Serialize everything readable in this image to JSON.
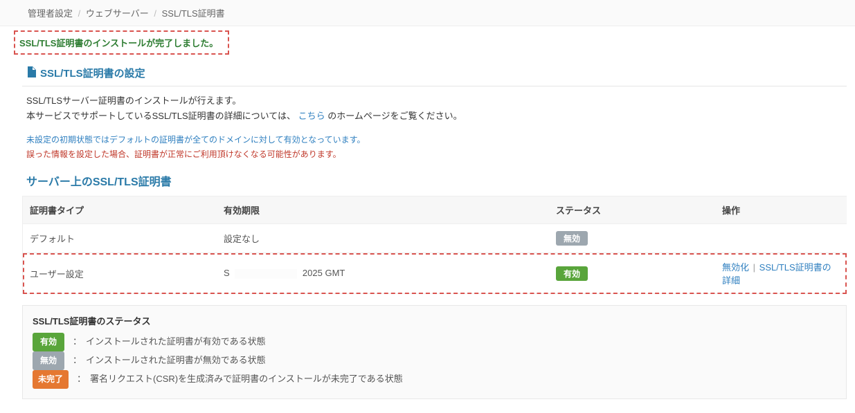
{
  "breadcrumb": {
    "item1": "管理者設定",
    "item2": "ウェブサーバー",
    "item3": "SSL/TLS証明書"
  },
  "success_message": "SSL/TLS証明書のインストールが完了しました。",
  "section": {
    "title": "SSL/TLS証明書の設定"
  },
  "description": {
    "line1": "SSL/TLSサーバー証明書のインストールが行えます。",
    "line2_prefix": "本サービスでサポートしているSSL/TLS証明書の詳細については、",
    "line2_link": "こちら",
    "line2_suffix": " のホームページをご覧ください。"
  },
  "notes": {
    "blue": "未設定の初期状態ではデフォルトの証明書が全てのドメインに対して有効となっています。",
    "red": "誤った情報を設定した場合、証明書が正常にご利用頂けなくなる可能性があります。"
  },
  "table": {
    "heading": "サーバー上のSSL/TLS証明書",
    "columns": {
      "type": "証明書タイプ",
      "expiry": "有効期限",
      "status": "ステータス",
      "action": "操作"
    },
    "rows": [
      {
        "type": "デフォルト",
        "expiry_prefix": "設定なし",
        "expiry_suffix": "",
        "status_label": "無効",
        "status_style": "badge-gray",
        "actions": []
      },
      {
        "type": "ユーザー設定",
        "expiry_prefix": "S",
        "expiry_suffix": "2025 GMT",
        "status_label": "有効",
        "status_style": "badge-green",
        "actions": [
          "無効化",
          "SSL/TLS証明書の詳細"
        ]
      }
    ]
  },
  "status_box": {
    "title": "SSL/TLS証明書のステータス",
    "items": [
      {
        "label": "有効",
        "style": "badge-green",
        "desc": "インストールされた証明書が有効である状態"
      },
      {
        "label": "無効",
        "style": "badge-gray",
        "desc": "インストールされた証明書が無効である状態"
      },
      {
        "label": "未完了",
        "style": "badge-orange",
        "desc": "署名リクエスト(CSR)を生成済みで証明書のインストールが未完了である状態"
      }
    ]
  }
}
